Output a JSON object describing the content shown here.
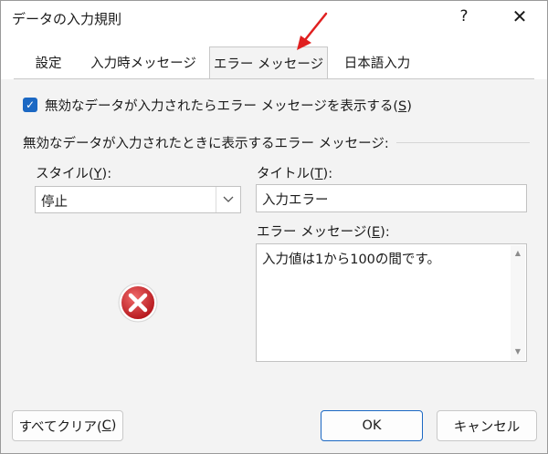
{
  "window": {
    "title": "データの入力規則",
    "help_label": "?",
    "close_label": "✕"
  },
  "tabs": [
    {
      "label": "設定",
      "active": false
    },
    {
      "label": "入力時メッセージ",
      "active": false
    },
    {
      "label": "エラー メッセージ",
      "active": true
    },
    {
      "label": "日本語入力",
      "active": false
    }
  ],
  "error_tab": {
    "show_error_checkbox": {
      "checked": true,
      "label_pre": "無効なデータが入力されたらエラー メッセージを表示する(",
      "mnemonic": "S",
      "label_post": ")"
    },
    "section_title": "無効なデータが入力されたときに表示するエラー メッセージ:",
    "style_label": {
      "pre": "スタイル(",
      "mnemonic": "Y",
      "post": "):"
    },
    "style_value": "停止",
    "title_label": {
      "pre": "タイトル(",
      "mnemonic": "T",
      "post": "):"
    },
    "title_value": "入力エラー",
    "message_label": {
      "pre": "エラー メッセージ(",
      "mnemonic": "E",
      "post": "):"
    },
    "message_value": "入力値は1から100の間です。",
    "icon": "error-stop-icon"
  },
  "footer": {
    "clear_all": {
      "pre": "すべてクリア(",
      "mnemonic": "C",
      "post": ")"
    },
    "ok_label": "OK",
    "cancel_label": "キャンセル"
  },
  "colors": {
    "accent": "#1b68c3",
    "error_red": "#c0272d",
    "annotation_arrow": "#e02020"
  }
}
